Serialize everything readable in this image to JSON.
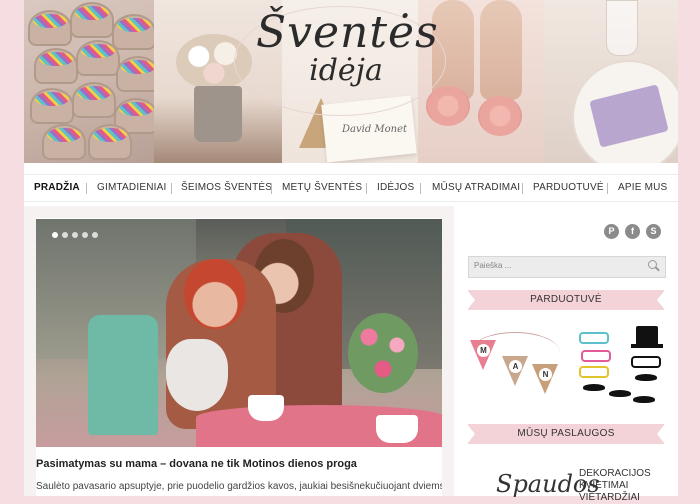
{
  "brand": {
    "title": "Šventės",
    "subtitle": "idėja",
    "card_text": "David Monet"
  },
  "nav": {
    "items": [
      {
        "label": "PRADŽIA",
        "active": true
      },
      {
        "label": "GIMTADIENIAI",
        "active": false
      },
      {
        "label": "ŠEIMOS ŠVENTĖS",
        "active": false
      },
      {
        "label": "METŲ ŠVENTĖS",
        "active": false
      },
      {
        "label": "IDĖJOS",
        "active": false
      },
      {
        "label": "MŪSŲ ATRADIMAI",
        "active": false
      },
      {
        "label": "PARDUOTUVĖ",
        "active": false
      },
      {
        "label": "APIE MUS",
        "active": false
      }
    ]
  },
  "slider": {
    "dots": 5,
    "active_dot": 1
  },
  "post": {
    "title": "Pasimatymas su mama – dovana ne tik Motinos dienos proga",
    "excerpt": "Saulėto pavasario apsuptyje, prie puodelio gardžios kavos, jaukiai besišnekučiuojant dviems"
  },
  "sidebar": {
    "social": [
      {
        "icon": "pinterest-icon",
        "glyph": "P"
      },
      {
        "icon": "facebook-icon",
        "glyph": "f"
      },
      {
        "icon": "skype-icon",
        "glyph": "S"
      }
    ],
    "search_placeholder": "Paieška ...",
    "shop_heading": "PARDUOTUVĖ",
    "bunting_letters": [
      "M",
      "A",
      "N"
    ],
    "services_heading": "MŪSŲ PASLAUGOS",
    "services_logo_text": "Spaudos",
    "services_text": "DEKORACIJOS KVIETIMAI VIETARDŽIAI"
  },
  "colors": {
    "page_bg": "#f5dde1",
    "ribbon": "#f3d3d8",
    "accent_pink": "#e87e92"
  }
}
